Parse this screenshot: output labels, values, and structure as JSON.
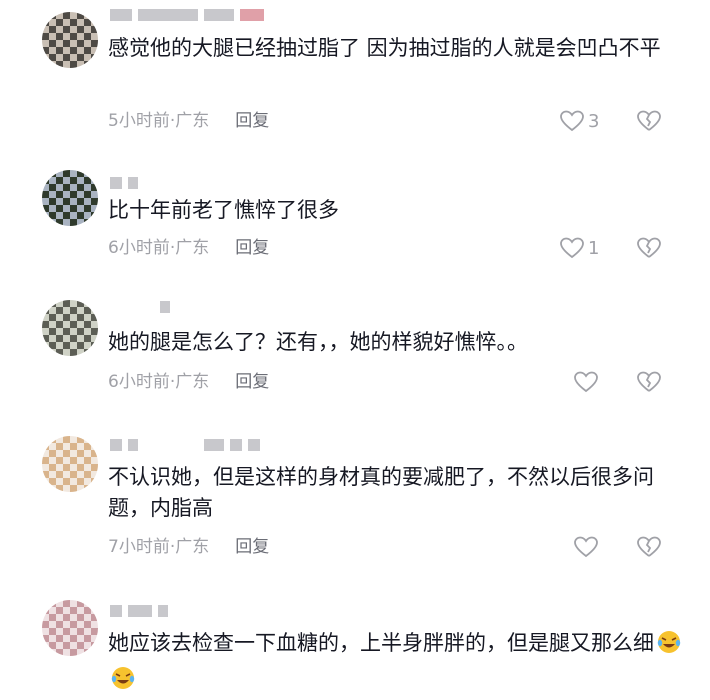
{
  "comments": [
    {
      "text": "感觉他的大腿已经抽过脂了 因为抽过脂的人就是会凹凸不平",
      "time": "5小时前",
      "location": "广东",
      "reply": "回复",
      "likes": "3"
    },
    {
      "text": "比十年前老了憔悴了很多",
      "time": "6小时前",
      "location": "广东",
      "reply": "回复",
      "likes": "1"
    },
    {
      "text": "她的腿是怎么了？还有，，她的样貌好憔悴。。",
      "time": "6小时前",
      "location": "广东",
      "reply": "回复",
      "likes": ""
    },
    {
      "text": "不认识她，但是这样的身材真的要减肥了，不然以后很多问题，内脂高",
      "time": "7小时前",
      "location": "广东",
      "reply": "回复",
      "likes": ""
    },
    {
      "text": "她应该去检查一下血糖的，上半身胖胖的，但是腿又那么细",
      "emojis": [
        "rofl-emoji",
        "rofl-emoji"
      ]
    }
  ],
  "separator": "·",
  "icons": {
    "like": "heart-outline-icon",
    "dislike": "broken-heart-icon"
  },
  "colors": {
    "text": "#161823",
    "meta": "#a0a1a7",
    "reply": "#6b6d76"
  }
}
